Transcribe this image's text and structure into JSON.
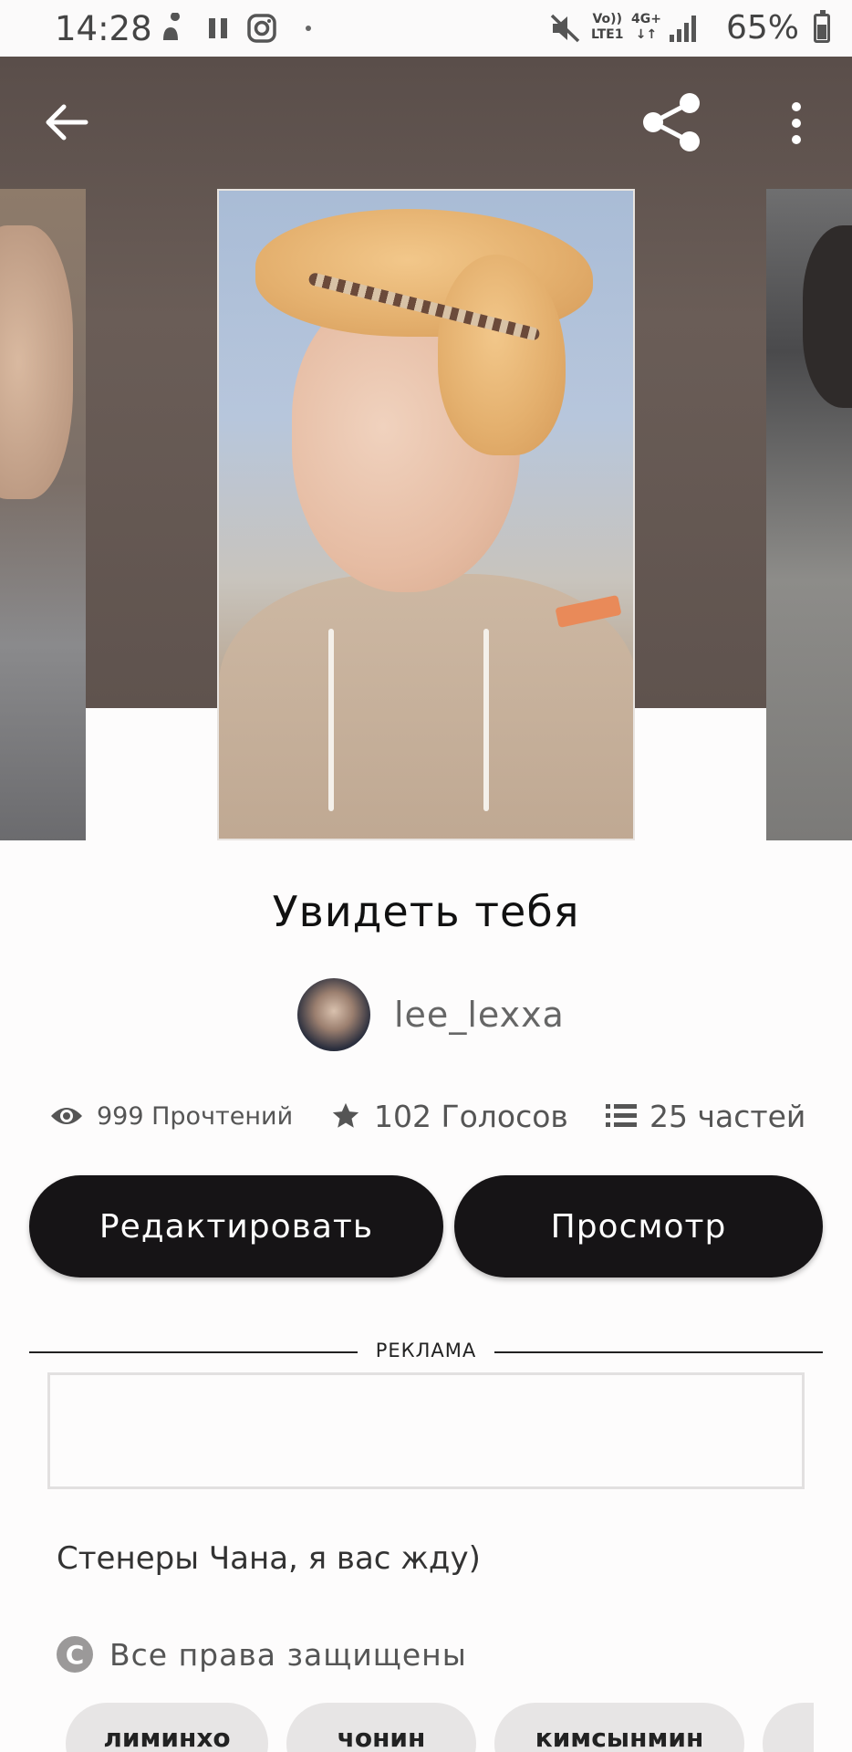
{
  "status_bar": {
    "time": "14:28",
    "net_top": "Vo))",
    "net_bottom": "LTE1",
    "net_type": "4G+",
    "battery": "65%"
  },
  "topbar": {
    "back_icon": "arrow-left-icon",
    "share_icon": "share-icon",
    "more_icon": "more-vertical-icon"
  },
  "story": {
    "title": "Увидеть тебя",
    "author": "lee_lexxa",
    "reads": "999 Прочтений",
    "votes": "102 Голосов",
    "parts": "25 частей"
  },
  "actions": {
    "edit_label": "Редактировать",
    "view_label": "Просмотр"
  },
  "ad": {
    "label": "РЕКЛАМА"
  },
  "description": "Стенеры Чана, я вас жду)",
  "rights": {
    "icon_glyph": "C",
    "text": "Все права защищены"
  },
  "tags": [
    "лиминхо",
    "чонин",
    "кимсынмин"
  ],
  "colors": {
    "button_bg": "#161416",
    "hero_bg": "#5a4e4a",
    "accent_text": "#555555"
  }
}
